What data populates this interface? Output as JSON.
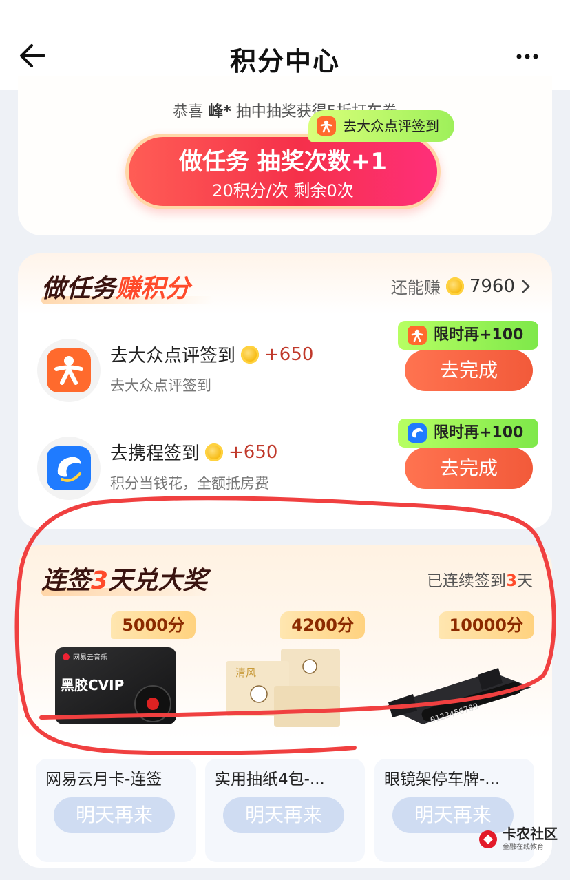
{
  "header": {
    "title": "积分中心"
  },
  "lottery": {
    "winner_prefix": "恭喜",
    "winner_name": "峰*",
    "winner_suffix": "抽中抽奖获得5折打车券",
    "main_label": "做任务 抽奖次数+1",
    "sub_label": "20积分/次 剩余0次",
    "float_tag": "去大众点评签到"
  },
  "tasks": {
    "heading_prefix": "做任务",
    "heading_highlight": "赚积分",
    "earn_more_label": "还能赚",
    "earn_more_value": "7960",
    "items": [
      {
        "title": "去大众点评签到",
        "reward": "+650",
        "desc": "去大众点评签到",
        "button": "去完成",
        "tag": "限时再+100",
        "icon": "dianping-icon"
      },
      {
        "title": "去携程签到",
        "reward": "+650",
        "desc": "积分当钱花，全额抵房费",
        "button": "去完成",
        "tag": "限时再+100",
        "icon": "ctrip-icon"
      }
    ]
  },
  "signin": {
    "heading_a": "连签",
    "heading_num": "3",
    "heading_b": "天兑大奖",
    "status_prefix": "已连续签到",
    "status_num": "3",
    "status_suffix": "天",
    "prizes": [
      {
        "points": "5000分",
        "name": "网易云月卡-连签",
        "button": "明天再来",
        "img_label": "黑胶CVIP",
        "img_brand": "网易云音乐"
      },
      {
        "points": "4200分",
        "name": "实用抽纸4包-...",
        "button": "明天再来",
        "img_label": "清风"
      },
      {
        "points": "10000分",
        "name": "眼镜架停车牌-...",
        "button": "明天再来",
        "img_label": "0123456789"
      }
    ]
  },
  "watermark": {
    "title": "卡农社区",
    "sub": "金融在线教育"
  },
  "colors": {
    "accent_red": "#f5304a",
    "task_button": "#f25a3a",
    "tag_green": "#9ef05a",
    "disabled_button": "#cfdcf2",
    "annotation": "#f04040"
  }
}
